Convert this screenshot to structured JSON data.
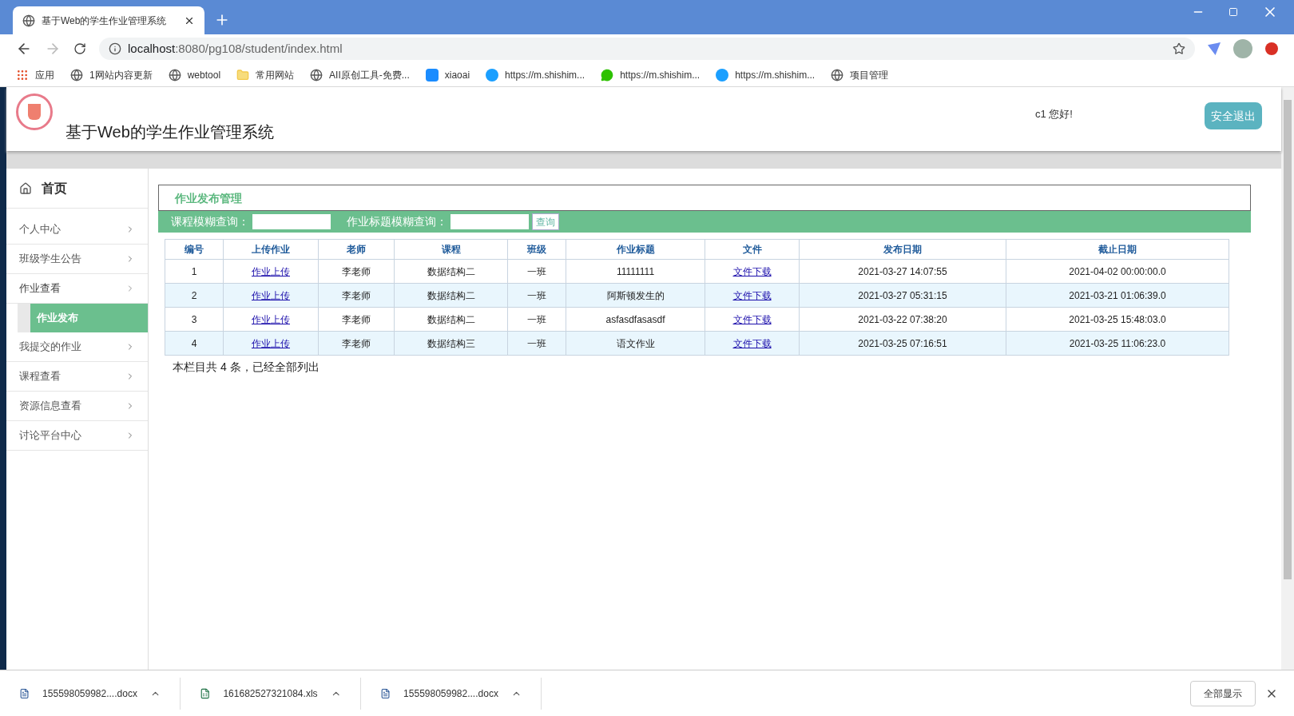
{
  "browser": {
    "tab_title": "基于Web的学生作业管理系统",
    "url_host": "localhost",
    "url_rest": ":8080/pg108/student/index.html",
    "bookmarks": [
      {
        "label": "应用",
        "kind": "apps"
      },
      {
        "label": "1网站内容更新",
        "kind": "globe"
      },
      {
        "label": "webtool",
        "kind": "globe"
      },
      {
        "label": "常用网站",
        "kind": "folder"
      },
      {
        "label": "AII原创工具-免费...",
        "kind": "globe"
      },
      {
        "label": "xiaoai",
        "kind": "p"
      },
      {
        "label": "https://m.shishim...",
        "kind": "c"
      },
      {
        "label": "https://m.shishim...",
        "kind": "chat"
      },
      {
        "label": "https://m.shishim...",
        "kind": "c"
      },
      {
        "label": "项目管理",
        "kind": "globe"
      }
    ]
  },
  "header": {
    "title": "基于Web的学生作业管理系统",
    "greeting": "c1 您好!",
    "logout": "安全退出"
  },
  "sidebar": {
    "home": "首页",
    "items": [
      {
        "label": "个人中心",
        "expanded": false
      },
      {
        "label": "班级学生公告",
        "expanded": false
      },
      {
        "label": "作业查看",
        "expanded": true,
        "children": [
          {
            "label": "作业发布",
            "selected": true
          }
        ]
      },
      {
        "label": "我提交的作业",
        "expanded": false
      },
      {
        "label": "课程查看",
        "expanded": false
      },
      {
        "label": "资源信息查看",
        "expanded": false
      },
      {
        "label": "讨论平台中心",
        "expanded": false
      }
    ]
  },
  "panel": {
    "title": "作业发布管理",
    "filters": [
      {
        "label": "课程模糊查询："
      },
      {
        "label": "作业标题模糊查询："
      }
    ],
    "search_button": "查询"
  },
  "table": {
    "columns": [
      {
        "label": "编号",
        "kind": "text"
      },
      {
        "label": "上传作业",
        "kind": "link"
      },
      {
        "label": "老师",
        "kind": "text"
      },
      {
        "label": "课程",
        "kind": "text"
      },
      {
        "label": "班级",
        "kind": "text"
      },
      {
        "label": "作业标题",
        "kind": "text"
      },
      {
        "label": "文件",
        "kind": "link"
      },
      {
        "label": "发布日期",
        "kind": "text"
      },
      {
        "label": "截止日期",
        "kind": "text"
      }
    ],
    "rows": [
      [
        "1",
        "作业上传",
        "李老师",
        "数据结构二",
        "一班",
        "11111111",
        "文件下载",
        "2021-03-27 14:07:55",
        "2021-04-02 00:00:00.0"
      ],
      [
        "2",
        "作业上传",
        "李老师",
        "数据结构二",
        "一班",
        "阿斯顿发生的",
        "文件下载",
        "2021-03-27 05:31:15",
        "2021-03-21 01:06:39.0"
      ],
      [
        "3",
        "作业上传",
        "李老师",
        "数据结构二",
        "一班",
        "asfasdfasasdf",
        "文件下载",
        "2021-03-22 07:38:20",
        "2021-03-25 15:48:03.0"
      ],
      [
        "4",
        "作业上传",
        "李老师",
        "数据结构三",
        "一班",
        "语文作业",
        "文件下载",
        "2021-03-25 07:16:51",
        "2021-03-25 11:06:23.0"
      ]
    ]
  },
  "summary": "本栏目共 4 条，已经全部列出",
  "downloads": {
    "files": [
      {
        "name": "155598059982....docx",
        "kind": "docx"
      },
      {
        "name": "161682527321084.xls",
        "kind": "xls"
      },
      {
        "name": "155598059982....docx",
        "kind": "docx"
      }
    ],
    "show_all": "全部显示"
  }
}
